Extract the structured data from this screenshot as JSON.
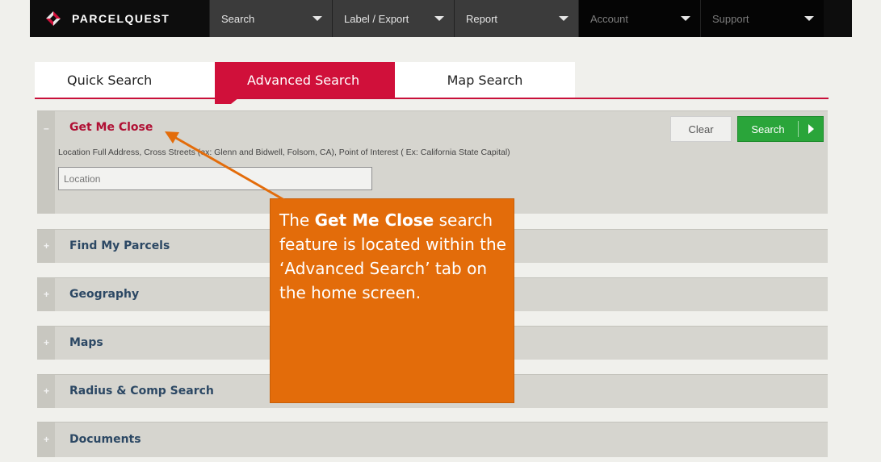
{
  "brand": {
    "name": "PARCELQUEST"
  },
  "nav": {
    "items": [
      {
        "label": "Search"
      },
      {
        "label": "Label / Export"
      },
      {
        "label": "Report"
      },
      {
        "label": "Account"
      },
      {
        "label": "Support"
      }
    ]
  },
  "tabs": [
    {
      "label": "Quick Search"
    },
    {
      "label": "Advanced Search"
    },
    {
      "label": "Map Search"
    }
  ],
  "get_me_close": {
    "title": "Get Me Close",
    "sign": "–",
    "hint": "Location Full Address, Cross Streets (ex: Glenn and Bidwell, Folsom, CA), Point of Interest ( Ex: California State Capital)",
    "location_placeholder": "Location",
    "clear_label": "Clear",
    "search_label": "Search"
  },
  "sections": [
    {
      "title": "Find My Parcels",
      "sign": "+"
    },
    {
      "title": "Geography",
      "sign": "+"
    },
    {
      "title": "Maps",
      "sign": "+"
    },
    {
      "title": "Radius & Comp Search",
      "sign": "+"
    },
    {
      "title": "Documents",
      "sign": "+"
    }
  ],
  "callout": {
    "text_pre": "The ",
    "text_bold": "Get Me Close",
    "text_post": " search feature is located within the ‘Advanced Search’ tab on the home screen."
  },
  "colors": {
    "accent": "#d0103a",
    "callout": "#e36c0a",
    "search_button": "#2aa53a",
    "nav_bg": "#0d0d0d"
  }
}
